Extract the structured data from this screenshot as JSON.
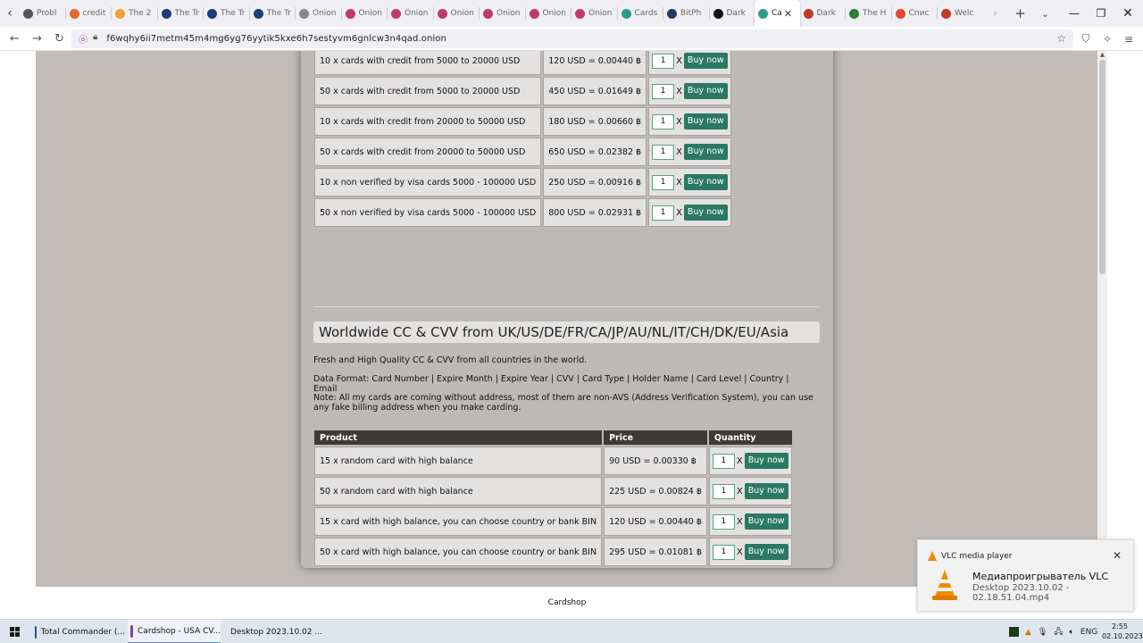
{
  "browser": {
    "tabs": [
      {
        "label": "Probl",
        "icon": "info-icon",
        "color": "#555"
      },
      {
        "label": "credit",
        "icon": "search-icon",
        "color": "#e8672c"
      },
      {
        "label": "The 2",
        "icon": "brand-icon",
        "color": "#f0a03a"
      },
      {
        "label": "The Tr",
        "icon": "w-icon",
        "color": "#1d3d7a"
      },
      {
        "label": "The Tr",
        "icon": "w-icon",
        "color": "#1d3d7a"
      },
      {
        "label": "The Tr",
        "icon": "w-icon",
        "color": "#1d3d7a"
      },
      {
        "label": "Onion",
        "icon": "globe-icon",
        "color": "#888"
      },
      {
        "label": "Onion",
        "icon": "onion-icon",
        "color": "#c03a6a"
      },
      {
        "label": "Onion",
        "icon": "onion-icon",
        "color": "#c03a6a"
      },
      {
        "label": "Onion",
        "icon": "onion-icon",
        "color": "#c03a6a"
      },
      {
        "label": "Onion",
        "icon": "onion-icon",
        "color": "#c03a6a"
      },
      {
        "label": "Onion",
        "icon": "onion-icon",
        "color": "#c03a6a"
      },
      {
        "label": "Onion",
        "icon": "onion-icon",
        "color": "#c03a6a"
      },
      {
        "label": "Cards",
        "icon": "cards-icon",
        "color": "#2a9d8f"
      },
      {
        "label": "BitPh",
        "icon": "b-icon",
        "color": "#203a6a"
      },
      {
        "label": "Dark",
        "icon": "h-icon",
        "color": "#111"
      },
      {
        "label": "Ca",
        "icon": "cards-icon",
        "color": "#2a9d8f",
        "active": true
      },
      {
        "label": "Dark",
        "icon": "dark-icon",
        "color": "#c0392b"
      },
      {
        "label": "The H",
        "icon": "leaf-icon",
        "color": "#2e7d32"
      },
      {
        "label": "Спис",
        "icon": "reddit-icon",
        "color": "#e8452c"
      },
      {
        "label": "Welc",
        "icon": "mail-icon",
        "color": "#c0392b"
      }
    ],
    "url": "f6wqhy6ii7metm45m4mg6yg76yytik5kxe6h7sestyvm6gnlcw3n4qad.onion"
  },
  "page": {
    "table1": {
      "rows": [
        {
          "product": "10 x cards with credit from 5000 to 20000 USD",
          "price": "120 USD = 0.00440 ฿",
          "qty": "1"
        },
        {
          "product": "50 x cards with credit from 5000 to 20000 USD",
          "price": "450 USD = 0.01649 ฿",
          "qty": "1"
        },
        {
          "product": "10 x cards with credit from 20000 to 50000 USD",
          "price": "180 USD = 0.00660 ฿",
          "qty": "1"
        },
        {
          "product": "50 x cards with credit from 20000 to 50000 USD",
          "price": "650 USD = 0.02382 ฿",
          "qty": "1"
        },
        {
          "product": "10 x non verified by visa cards 5000 - 100000 USD",
          "price": "250 USD = 0.00916 ฿",
          "qty": "1"
        },
        {
          "product": "50 x non verified by visa cards 5000 - 100000 USD",
          "price": "800 USD = 0.02931 ฿",
          "qty": "1"
        }
      ]
    },
    "section": {
      "title": "Worldwide CC & CVV from UK/US/DE/FR/CA/JP/AU/NL/IT/CH/DK/EU/Asia",
      "intro": "Fresh and High Quality CC & CVV from all countries in the world.",
      "format": "Data Format: Card Number | Expire Month | Expire Year | CVV | Card Type | Holder Name | Card Level | Country | Email",
      "note": "Note: All my cards are coming without address, most of them are non-AVS (Address Verification System), you can use any fake billing address when you make carding."
    },
    "table2": {
      "headers": {
        "product": "Product",
        "price": "Price",
        "quantity": "Quantity"
      },
      "rows": [
        {
          "product": "15 x random card with high balance",
          "price": "90 USD = 0.00330 ฿",
          "qty": "1"
        },
        {
          "product": "50 x random card with high balance",
          "price": "225 USD = 0.00824 ฿",
          "qty": "1"
        },
        {
          "product": "15 x card with high balance, you can choose country or bank BIN",
          "price": "120 USD = 0.00440 ฿",
          "qty": "1"
        },
        {
          "product": "50 x card with high balance, you can choose country or bank BIN",
          "price": "295 USD = 0.01081 ฿",
          "qty": "1"
        }
      ]
    },
    "buy_label": "Buy now",
    "times_label": "X",
    "footer": "Cardshop"
  },
  "notification": {
    "app": "VLC media player",
    "title": "Медиапроигрыватель VLC",
    "body": "Desktop 2023.10.02 - 02.18.51.04.mp4"
  },
  "taskbar": {
    "items": [
      {
        "label": "Total Commander (...",
        "icon": "total-commander-icon",
        "color": "#2a4fa0"
      },
      {
        "label": "Cardshop - USA CV...",
        "icon": "tor-browser-icon",
        "color": "#7d3fa8",
        "active": true
      },
      {
        "label": "Desktop 2023.10.02 ...",
        "icon": "vlc-icon",
        "color": "#f08a00"
      }
    ],
    "lang": "ENG",
    "time": "2:55",
    "date": "02.10.2023"
  },
  "colors": {
    "buy_button": "#2b7963",
    "page_bg": "#c1bcb8",
    "header_row": "#3d3a38"
  }
}
